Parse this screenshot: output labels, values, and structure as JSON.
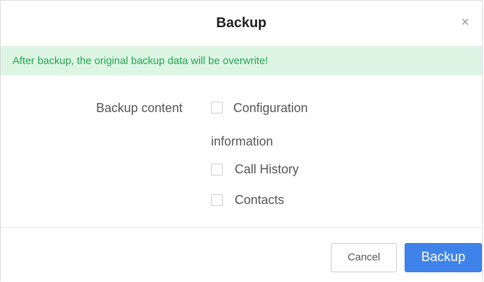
{
  "dialog": {
    "title": "Backup",
    "close_symbol": "×",
    "warning": "After backup, the original backup data will be overwrite!",
    "form": {
      "label": "Backup content",
      "options": [
        {
          "label": "Configuration information",
          "checked": false
        },
        {
          "label": "Call History",
          "checked": false
        },
        {
          "label": "Contacts",
          "checked": false
        }
      ]
    },
    "buttons": {
      "cancel": "Cancel",
      "backup": "Backup"
    },
    "colors": {
      "primary": "#3f82ea",
      "warning_bg": "#ddf6e3",
      "warning_text": "#20a650"
    }
  }
}
